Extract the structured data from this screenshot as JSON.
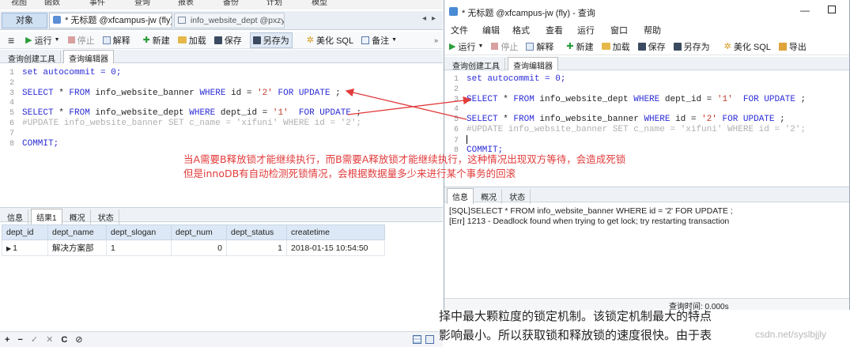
{
  "left": {
    "menu": [
      "视图",
      "函数",
      "事件",
      "查询",
      "报表",
      "备份",
      "计划",
      "模型"
    ],
    "tabs": {
      "object": "对象",
      "query_tab": "* 无标题 @xfcampus-jw (fly) ...",
      "table_tab": "info_website_dept @pxzyzx ..."
    },
    "toolbar": {
      "run": "运行",
      "stop": "停止",
      "explain": "解释",
      "new": "新建",
      "load": "加载",
      "save": "保存",
      "save_as": "另存为",
      "beautify": "美化 SQL",
      "note": "备注"
    },
    "subtabs": [
      "查询创建工具",
      "查询编辑器"
    ],
    "code": {
      "l1_a": "set autocommit = 0;",
      "l3_kw1": "SELECT",
      "l3_t1": " * ",
      "l3_kw2": "FROM",
      "l3_t2": " info_website_banner ",
      "l3_kw3": "WHERE",
      "l3_t3": " id = ",
      "l3_str": "'2'",
      "l3_kw4": " FOR UPDATE",
      "l3_end": " ;",
      "l5_kw1": "SELECT",
      "l5_t1": " * ",
      "l5_kw2": "FROM",
      "l5_t2": " info_website_dept ",
      "l5_kw3": "WHERE",
      "l5_t3": " dept_id = ",
      "l5_str": "'1'",
      "l5_kw4": "  FOR UPDATE",
      "l5_end": " ;",
      "l6": "#UPDATE info_website_banner SET c_name = 'xifuni' WHERE id = '2';",
      "l8": "COMMIT;"
    },
    "result_tabs": [
      "信息",
      "结果1",
      "概况",
      "状态"
    ],
    "result": {
      "headers": [
        "dept_id",
        "dept_name",
        "dept_slogan",
        "dept_num",
        "dept_status",
        "createtime"
      ],
      "row": [
        "1",
        "解决方案部",
        "1",
        "0",
        "1",
        "2018-01-15 10:54:50"
      ]
    },
    "bottom_icons": [
      "+",
      "−",
      "✓",
      "✕",
      "C",
      "⊘"
    ]
  },
  "right": {
    "title": "* 无标题 @xfcampus-jw (fly) - 查询",
    "menu": [
      "文件",
      "编辑",
      "格式",
      "查看",
      "运行",
      "窗口",
      "帮助"
    ],
    "toolbar": {
      "run": "运行",
      "stop": "停止",
      "explain": "解释",
      "new": "新建",
      "load": "加载",
      "save": "保存",
      "save_as": "另存为",
      "beautify": "美化 SQL",
      "export": "导出"
    },
    "subtabs": [
      "查询创建工具",
      "查询编辑器"
    ],
    "code": {
      "l1": "set autocommit = 0;",
      "l3_kw1": "SELECT",
      "l3_t1": " * ",
      "l3_kw2": "FROM",
      "l3_t2": " info_website_dept ",
      "l3_kw3": "WHERE",
      "l3_t3": " dept_id = ",
      "l3_str": "'1'",
      "l3_kw4": "  FOR UPDATE",
      "l3_end": " ;",
      "l5_kw1": "SELECT",
      "l5_t1": " * ",
      "l5_kw2": "FROM",
      "l5_t2": " info_website_banner ",
      "l5_kw3": "WHERE",
      "l5_t3": " id = ",
      "l5_str": "'2'",
      "l5_kw4": " FOR UPDATE",
      "l5_end": " ;",
      "l6": "#UPDATE info_website_banner SET c_name = 'xifuni' WHERE id = '2';",
      "l8": "COMMIT;"
    },
    "result_tabs": [
      "信息",
      "概况",
      "状态"
    ],
    "messages": [
      "[SQL]SELECT * FROM info_website_banner WHERE id = '2' FOR UPDATE ;",
      "[Err] 1213 - Deadlock found when trying to get lock; try restarting transaction"
    ],
    "query_time": "查询时间: 0.000s"
  },
  "annotation": {
    "line1": "当A需要B释放锁才能继续执行，而B需要A释放锁才能继续执行，这种情况出现双方等待，会造成死锁",
    "line2": "但是innoDB有自动检测死锁情况，会根据数据量多少来进行某个事务的回滚",
    "color": "#e23b3b"
  },
  "background_text": {
    "line1": "择中最大颗粒度的锁定机制。该锁定机制最大的特点",
    "line2": "影响最小。所以获取锁和释放锁的速度很快。由于表",
    "watermark": "csdn.net/syslbjjly"
  }
}
